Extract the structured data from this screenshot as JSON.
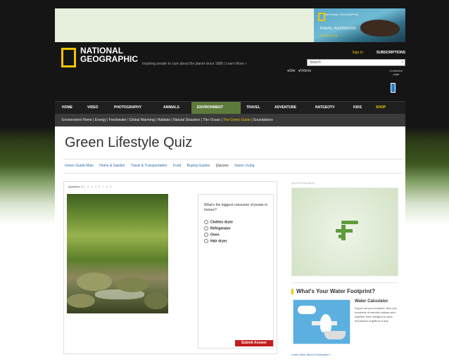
{
  "top_ad": {
    "brand": "NATIONAL GEOGRAPHIC",
    "headline": "TRAVEL INSPIRATION",
    "cta": "LEARN MORE"
  },
  "header": {
    "logo_line1": "NATIONAL",
    "logo_line2": "GEOGRAPHIC",
    "tagline": "Inspiring people to care about the planet since 1888  |  Learn More »",
    "sign_in": "Sign In",
    "subscription": "SUBSCRIPTIONS",
    "search_placeholder": "Search",
    "search_option_site": "Site",
    "search_option_videos": "Videos",
    "customize": "Customize page"
  },
  "nav": {
    "items": [
      "HOME",
      "VIDEO",
      "PHOTOGRAPHY",
      "ANIMALS",
      "ENVIRONMENT",
      "TRAVEL",
      "ADVENTURE",
      "NATGEOTV",
      "KIDS",
      "SHOP"
    ],
    "active": "ENVIRONMENT"
  },
  "subnav": {
    "items": [
      "Environment Home",
      "Energy",
      "Freshwater",
      "Global Warming",
      "Habitats",
      "Natural Disasters",
      "The Ocean",
      "The Green Guide",
      "Soundations"
    ],
    "active": "The Green Guide"
  },
  "page": {
    "title": "Green Lifestyle Quiz",
    "links": [
      "Green Guide Main",
      "Home & Garden",
      "Travel & Transportation",
      "Food",
      "Buying Guides",
      "Quizzes",
      "Green Living"
    ],
    "current_link": "Quizzes"
  },
  "quiz": {
    "counter_label": "Question:",
    "current": "1",
    "numbers": "2  3  4  5  6  7  8  9",
    "question": "What's the biggest consumer of power in homes?",
    "options": [
      "Clothes dryer",
      "Refrigerator",
      "Oven",
      "Hair dryer"
    ],
    "submit_label": "Submit Answer"
  },
  "sidebar": {
    "ad_label": "ADVERTISEMENT",
    "water_title": "What's Your Water Footprint?",
    "calc_title": "Water Calculator",
    "calc_desc": "Figure out your footprint, then join hundreds of website visitors who together have pledged to save thousands of gallons a day.",
    "learn_more": "Learn More About Freshwater »"
  },
  "colors": {
    "brand_yellow": "#f2c400",
    "nav_active": "#5d7a3a",
    "submit_red": "#c41c1c",
    "link_blue": "#2e6aa8"
  }
}
